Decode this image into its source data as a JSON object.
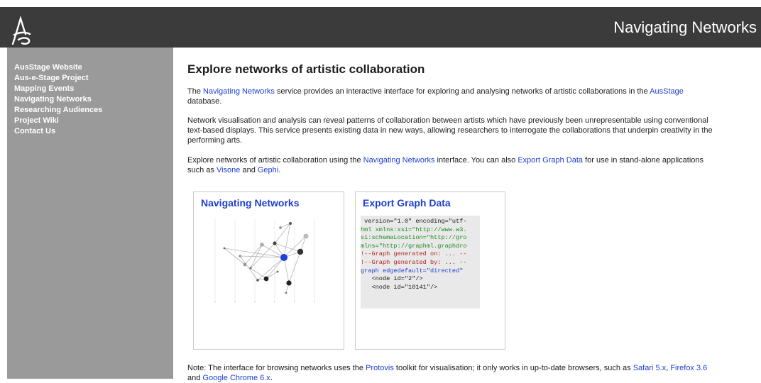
{
  "header": {
    "site_title": "Navigating Networks",
    "background": "#3b3b3b"
  },
  "sidebar": {
    "items": [
      {
        "label": "AusStage Website"
      },
      {
        "label": "Aus-e-Stage Project"
      },
      {
        "label": "Mapping Events"
      },
      {
        "label": "Navigating Networks"
      },
      {
        "label": "Researching Audiences"
      },
      {
        "label": "Project Wiki"
      },
      {
        "label": "Contact Us"
      }
    ],
    "background": "#9a9a9a"
  },
  "main": {
    "heading": "Explore networks of artistic collaboration",
    "intro": {
      "t1": "The ",
      "link_nav": "Navigating Networks",
      "t2": " service provides an interactive interface for exploring and analysing networks of artistic collaborations in the ",
      "link_ausstage": "AusStage",
      "t3": "\ndatabase."
    },
    "network_text": "Network visualisation and analysis can reveal patterns of collaboration between artists which have previously been unrepresentable using conventional\ntext-based displays. This service presents existing data in new ways, allowing researchers to interrogate the collaborations that underpin creativity in the\nperforming arts.",
    "explore": {
      "t1": "Explore networks of artistic collaboration using the ",
      "link_nav": "Navigating Networks",
      "t2": " interface. You can also ",
      "link_export": "Export Graph Data",
      "t3": " for use in stand-alone applications\nsuch as ",
      "link_visone": "Visone",
      "t4": " and ",
      "link_gephi": "Gephi",
      "t5": "."
    },
    "cards": {
      "navigating": {
        "title": "Navigating Networks"
      },
      "export": {
        "title": "Export Graph Data",
        "code_lines": [
          {
            "text": " version=\"1.0\" encoding=\"utf-",
            "color": "#1a1a1a"
          },
          {
            "text": "hml xmlns:xsi=\"http://www.w3.",
            "color": "#1f8a1f"
          },
          {
            "text": "si:schemaLocation=\"http://gro",
            "color": "#1f8a1f"
          },
          {
            "text": "mlns=\"http://graphml.graphdro",
            "color": "#1f8a1f"
          },
          {
            "text": "!--Graph generated on: ... --",
            "color": "#b22222"
          },
          {
            "text": "!--Graph generated by: ... --",
            "color": "#b22222"
          },
          {
            "text": "graph edgedefault=\"directed\"",
            "color": "#1f3ed0"
          },
          {
            "text": "   <node id=\"2\"/>",
            "color": "#1a1a1a"
          },
          {
            "text": "   <node id=\"10141\"/>",
            "color": "#1a1a1a"
          }
        ]
      }
    },
    "note": {
      "t1": "Note: The interface for browsing networks uses the ",
      "link_protovis": "Protovis",
      "t2": " toolkit for visualisation; it only works in up-to-date browsers, such as ",
      "link_safari": "Safari 5.x",
      "t3": ", ",
      "link_firefox": "Firefox 3.6",
      "t4": "\nand ",
      "link_chrome": "Google Chrome 6.x",
      "t5": "."
    }
  },
  "colors": {
    "link": "#1f3ed0",
    "highlight_node": "#1f3ee0"
  }
}
